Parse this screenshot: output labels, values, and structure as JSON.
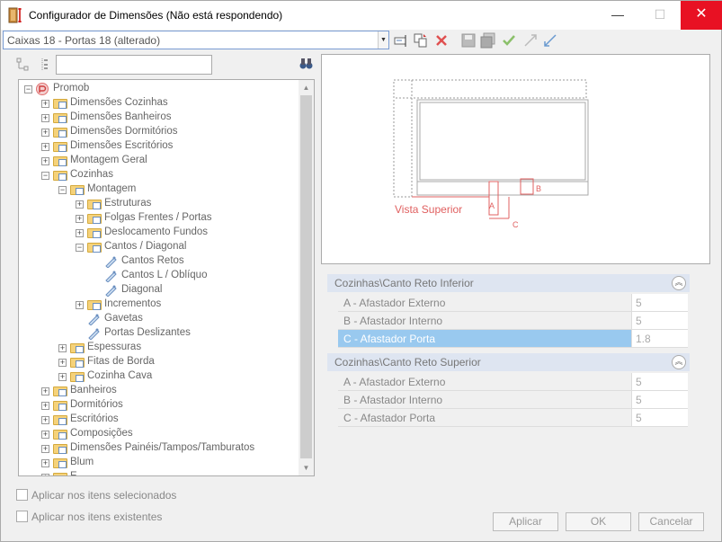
{
  "window": {
    "title": "Configurador de Dimensões (Não está respondendo)",
    "minimize": "—",
    "maximize": "☐",
    "close": "✕"
  },
  "toolbar": {
    "combo_value": "Caixas 18 - Portas 18 (alterado)"
  },
  "tree": [
    {
      "label": "Promob",
      "level": 0,
      "expander": "−",
      "icon": "promob"
    },
    {
      "label": "Dimensões Cozinhas",
      "level": 1,
      "expander": "+",
      "icon": "folder"
    },
    {
      "label": "Dimensões Banheiros",
      "level": 1,
      "expander": "+",
      "icon": "folder"
    },
    {
      "label": "Dimensões Dormitórios",
      "level": 1,
      "expander": "+",
      "icon": "folder"
    },
    {
      "label": "Dimensões Escritórios",
      "level": 1,
      "expander": "+",
      "icon": "folder"
    },
    {
      "label": "Montagem Geral",
      "level": 1,
      "expander": "+",
      "icon": "folder"
    },
    {
      "label": "Cozinhas",
      "level": 1,
      "expander": "−",
      "icon": "folder"
    },
    {
      "label": "Montagem",
      "level": 2,
      "expander": "−",
      "icon": "folder"
    },
    {
      "label": "Estruturas",
      "level": 3,
      "expander": "+",
      "icon": "folder"
    },
    {
      "label": "Folgas Frentes / Portas",
      "level": 3,
      "expander": "+",
      "icon": "folder"
    },
    {
      "label": "Deslocamento Fundos",
      "level": 3,
      "expander": "+",
      "icon": "folder"
    },
    {
      "label": "Cantos / Diagonal",
      "level": 3,
      "expander": "−",
      "icon": "folder"
    },
    {
      "label": "Cantos Retos",
      "level": 4,
      "expander": "",
      "icon": "leaf"
    },
    {
      "label": "Cantos L / Oblíquo",
      "level": 4,
      "expander": "",
      "icon": "leaf"
    },
    {
      "label": "Diagonal",
      "level": 4,
      "expander": "",
      "icon": "leaf"
    },
    {
      "label": "Incrementos",
      "level": 3,
      "expander": "+",
      "icon": "folder"
    },
    {
      "label": "Gavetas",
      "level": 3,
      "expander": "",
      "icon": "leaf"
    },
    {
      "label": "Portas Deslizantes",
      "level": 3,
      "expander": "",
      "icon": "leaf"
    },
    {
      "label": "Espessuras",
      "level": 2,
      "expander": "+",
      "icon": "folder"
    },
    {
      "label": "Fitas de Borda",
      "level": 2,
      "expander": "+",
      "icon": "folder"
    },
    {
      "label": "Cozinha Cava",
      "level": 2,
      "expander": "+",
      "icon": "folder"
    },
    {
      "label": "Banheiros",
      "level": 1,
      "expander": "+",
      "icon": "folder"
    },
    {
      "label": "Dormitórios",
      "level": 1,
      "expander": "+",
      "icon": "folder"
    },
    {
      "label": "Escritórios",
      "level": 1,
      "expander": "+",
      "icon": "folder"
    },
    {
      "label": "Composições",
      "level": 1,
      "expander": "+",
      "icon": "folder"
    },
    {
      "label": "Dimensões Painéis/Tampos/Tamburatos",
      "level": 1,
      "expander": "+",
      "icon": "folder"
    },
    {
      "label": "Blum",
      "level": 1,
      "expander": "+",
      "icon": "folder"
    },
    {
      "label": "E",
      "level": 1,
      "expander": "+",
      "icon": "folder"
    }
  ],
  "preview": {
    "caption": "Vista Superior",
    "label_a": "A",
    "label_b": "B",
    "label_c": "C",
    "accent_color": "#e06060"
  },
  "sections": [
    {
      "title": "Cozinhas\\Canto Reto Inferior",
      "rows": [
        {
          "label": "A - Afastador Externo",
          "value": "5",
          "selected": false
        },
        {
          "label": "B - Afastador Interno",
          "value": "5",
          "selected": false
        },
        {
          "label": "C - Afastador Porta",
          "value": "1.8",
          "selected": true
        }
      ]
    },
    {
      "title": "Cozinhas\\Canto Reto Superior",
      "rows": [
        {
          "label": "A - Afastador Externo",
          "value": "5",
          "selected": false
        },
        {
          "label": "B - Afastador Interno",
          "value": "5",
          "selected": false
        },
        {
          "label": "C - Afastador Porta",
          "value": "5",
          "selected": false
        }
      ]
    }
  ],
  "options": {
    "apply_selected": "Aplicar nos itens selecionados",
    "apply_existing": "Aplicar nos itens existentes"
  },
  "buttons": {
    "apply": "Aplicar",
    "ok": "OK",
    "cancel": "Cancelar"
  }
}
